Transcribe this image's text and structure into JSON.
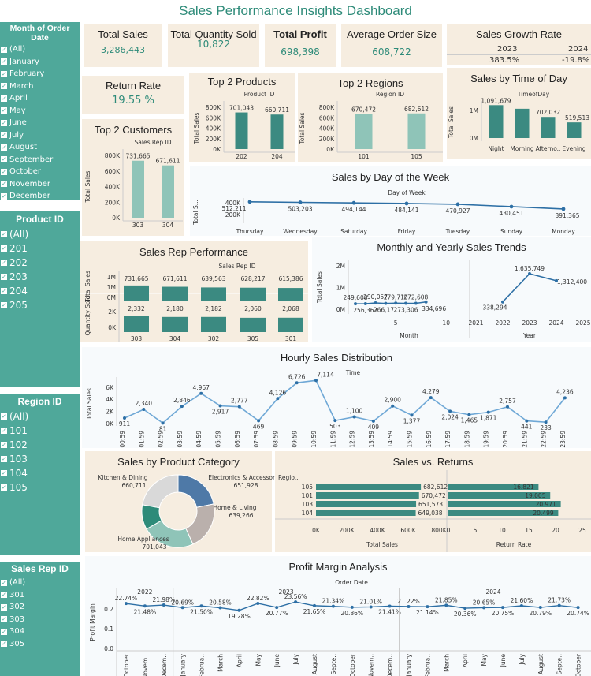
{
  "title": "Sales Performance Insights Dashboard",
  "filters": {
    "month": {
      "title": "Month of Order Date",
      "items": [
        "(All)",
        "January",
        "February",
        "March",
        "April",
        "May",
        "June",
        "July",
        "August",
        "September",
        "October",
        "November",
        "December"
      ]
    },
    "product": {
      "title": "Product ID",
      "items": [
        "(All)",
        "201",
        "202",
        "203",
        "204",
        "205"
      ]
    },
    "region": {
      "title": "Region ID",
      "items": [
        "(All)",
        "101",
        "102",
        "103",
        "104",
        "105"
      ]
    },
    "salesrep": {
      "title": "Sales Rep ID",
      "items": [
        "(All)",
        "301",
        "302",
        "303",
        "304",
        "305"
      ]
    }
  },
  "kpis": {
    "total_sales": {
      "label": "Total Sales",
      "value": "3,286,443"
    },
    "total_quantity": {
      "label": "Total Quantity Sold",
      "value": "10,822"
    },
    "total_profit": {
      "label": "Total Profit",
      "value": "698,398"
    },
    "avg_order": {
      "label": "Average Order Size",
      "value": "608,722"
    },
    "growth": {
      "label": "Sales Growth Rate",
      "y1": "2023",
      "y2": "2024",
      "v1": "383.5%",
      "v2": "-19.8%"
    },
    "return_rate": {
      "label": "Return Rate",
      "value": "19.55 %"
    }
  },
  "colors": {
    "sidebar": "#4fa89a",
    "bar_dark": "#3b8a81",
    "bar_light": "#8fc4b8",
    "line": "#2d6fa5",
    "line_light": "#6fa8d6"
  },
  "chart_data": [
    {
      "id": "top2products",
      "type": "bar",
      "title": "Top 2 Products",
      "xlabel": "Product ID",
      "ylabel": "Total Sales",
      "categories": [
        "202",
        "204"
      ],
      "values": [
        701043,
        660711
      ],
      "value_labels": [
        "701,043",
        "660,711"
      ],
      "ylim": [
        0,
        800000
      ],
      "yticks": [
        "0K",
        "200K",
        "400K",
        "600K",
        "800K"
      ]
    },
    {
      "id": "top2regions",
      "type": "bar",
      "title": "Top 2 Regions",
      "xlabel": "Region ID",
      "ylabel": "Total Sales",
      "categories": [
        "101",
        "105"
      ],
      "values": [
        670472,
        682612
      ],
      "value_labels": [
        "670,472",
        "682,612"
      ],
      "ylim": [
        0,
        800000
      ],
      "yticks": [
        "0K",
        "200K",
        "400K",
        "600K",
        "800K"
      ]
    },
    {
      "id": "top2customers",
      "type": "bar",
      "title": "Top 2 Customers",
      "xlabel": "Sales Rep ID",
      "ylabel": "Total Sales",
      "categories": [
        "303",
        "304"
      ],
      "values": [
        731665,
        671611
      ],
      "value_labels": [
        "731,665",
        "671,611"
      ],
      "ylim": [
        0,
        800000
      ],
      "yticks": [
        "0K",
        "200K",
        "400K",
        "600K",
        "800K"
      ]
    },
    {
      "id": "timeofday",
      "type": "bar",
      "title": "Sales by Time of Day",
      "xlabel": "TimeofDay",
      "ylabel": "Total Sales",
      "categories": [
        "Night",
        "Morning",
        "Afterno..",
        "Evening"
      ],
      "values": [
        1091679,
        972578,
        702032,
        519513
      ],
      "value_labels": [
        "1,091,679",
        "",
        "702,032",
        "519,513"
      ],
      "ylim": [
        0,
        1000000
      ],
      "yticks": [
        "0M",
        "1M"
      ]
    },
    {
      "id": "dayofweek",
      "type": "line",
      "title": "Sales by Day of the Week",
      "xlabel": "Day of Week",
      "ylabel": "Total S...",
      "categories": [
        "Thursday",
        "Wednesday",
        "Saturday",
        "Friday",
        "Tuesday",
        "Sunday",
        "Monday"
      ],
      "values": [
        512211,
        503203,
        494144,
        484141,
        470927,
        430451,
        391365
      ],
      "value_labels": [
        "512,211",
        "503,203",
        "494,144",
        "484,141",
        "470,927",
        "430,451",
        "391,365"
      ],
      "yticks": [
        "200K",
        "400K"
      ]
    },
    {
      "id": "salesrep",
      "type": "bar",
      "title": "Sales Rep Performance",
      "xlabel": "Sales Rep ID",
      "categories": [
        "303",
        "304",
        "302",
        "305",
        "301"
      ],
      "series": [
        {
          "name": "Total Sales",
          "values": [
            731665,
            671611,
            639563,
            628217,
            615386
          ],
          "value_labels": [
            "731,665",
            "671,611",
            "639,563",
            "628,217",
            "615,386"
          ],
          "yticks": [
            "0M",
            "1M",
            "1M"
          ]
        },
        {
          "name": "Quantity Sold",
          "values": [
            2332,
            2180,
            2182,
            2060,
            2068
          ],
          "value_labels": [
            "2,332",
            "2,180",
            "2,182",
            "2,060",
            "2,068"
          ],
          "yticks": [
            "0K",
            "2K"
          ]
        }
      ]
    },
    {
      "id": "monthly_yearly",
      "type": "line",
      "title": "Monthly and Yearly Sales Trends",
      "ylabel": "Total Sales",
      "monthly": {
        "xlabel": "Month",
        "x": [
          1,
          2,
          3,
          4,
          5,
          6,
          7,
          8,
          9,
          10,
          11,
          12
        ],
        "values": [
          249608,
          256367,
          290057,
          266171,
          279710,
          273306,
          272608,
          334696
        ],
        "value_labels": [
          "249,608",
          "256,367",
          "290,057",
          "266,171",
          "279,710",
          "273,306",
          "272,608",
          "334,696"
        ],
        "xticks": [
          "5",
          "10"
        ]
      },
      "yearly": {
        "xlabel": "Year",
        "x": [
          2022,
          2023,
          2024
        ],
        "values": [
          338294,
          1635749,
          1312400
        ],
        "value_labels": [
          "338,294",
          "1,635,749",
          "1,312,400"
        ],
        "xticks": [
          "2021",
          "2022",
          "2023",
          "2024",
          "2025"
        ]
      },
      "yticks": [
        "0M",
        "1M",
        "2M"
      ]
    },
    {
      "id": "hourly",
      "type": "line",
      "title": "Hourly Sales Distribution",
      "xlabel": "Time",
      "ylabel": "Total Sales",
      "categories": [
        "00:59",
        "01:59",
        "02:59",
        "03:59",
        "04:59",
        "05:59",
        "06:59",
        "07:59",
        "08:59",
        "09:59",
        "10:59",
        "11:59",
        "12:59",
        "13:59",
        "14:59",
        "15:59",
        "16:59",
        "17:59",
        "18:59",
        "19:59",
        "20:59",
        "21:59",
        "22:59",
        "23:59"
      ],
      "values": [
        911,
        2340,
        81,
        2846,
        4967,
        2917,
        2777,
        469,
        4126,
        6726,
        7114,
        503,
        1100,
        409,
        2900,
        1377,
        4279,
        2024,
        1465,
        1871,
        2757,
        441,
        233,
        4236
      ],
      "value_labels": [
        "911",
        "2,340",
        "81",
        "2,846",
        "4,967",
        "2,917",
        "2,777",
        "469",
        "4,126",
        "6,726",
        "7,114",
        "503",
        "1,100",
        "409",
        "2,900",
        "1,377",
        "4,279",
        "2,024",
        "1,465",
        "1,871",
        "2,757",
        "441",
        "233",
        "4,236"
      ],
      "yticks": [
        "0K",
        "2K",
        "4K",
        "6K"
      ],
      "ylim": [
        0,
        6500
      ]
    },
    {
      "id": "category",
      "type": "pie",
      "title": "Sales by Product Category",
      "slices": [
        {
          "name": "Electronics & Accessories",
          "value": 651928,
          "label": "651,928",
          "color": "#4e79a7"
        },
        {
          "name": "Home & Living",
          "value": 639266,
          "label": "639,266",
          "color": "#bab0ac"
        },
        {
          "name": "Home Appliances",
          "value": 701043,
          "label": "701,043",
          "color": "#8fc4b8"
        },
        {
          "name": "",
          "value": 330000,
          "label": "",
          "color": "#2e8b79"
        },
        {
          "name": "Kitchen & Dining",
          "value": 660711,
          "label": "660,711",
          "color": "#d9d9d9"
        }
      ]
    },
    {
      "id": "sales_returns",
      "type": "bar",
      "title": "Sales vs. Returns",
      "rowheader": "Regio..",
      "categories": [
        "105",
        "101",
        "103",
        "104"
      ],
      "sales": [
        682612,
        670472,
        651573,
        649038
      ],
      "sales_labels": [
        "682,612",
        "670,472",
        "651,573",
        "649,038"
      ],
      "returns": [
        16.821,
        19.005,
        20.971,
        20.499
      ],
      "return_labels": [
        "16.821",
        "19.005",
        "20.971",
        "20.499"
      ],
      "xlabel_sales": "Total Sales",
      "xlabel_returns": "Return Rate",
      "sales_ticks": [
        "0K",
        "200K",
        "400K",
        "600K",
        "800K"
      ],
      "return_ticks": [
        "0",
        "5",
        "10",
        "15",
        "20",
        "25"
      ]
    },
    {
      "id": "profit_margin",
      "type": "line",
      "title": "Profit Margin Analysis",
      "xlabel": "Order Date",
      "ylabel": "Profit Margin",
      "yticks": [
        "0.0",
        "0.1",
        "0.2"
      ],
      "years": [
        {
          "year": "2022",
          "months": [
            "October",
            "Novem..",
            "Decem.."
          ],
          "values": [
            0.2274,
            0.2148,
            0.2198
          ],
          "labels": [
            "22.74%",
            "21.48%",
            "21.98%"
          ]
        },
        {
          "year": "2023",
          "months": [
            "January",
            "Februa..",
            "March",
            "April",
            "May",
            "June",
            "July",
            "August",
            "Septe..",
            "October",
            "Novem..",
            "Decem.."
          ],
          "values": [
            0.2069,
            0.215,
            0.2058,
            0.1928,
            0.2282,
            0.2077,
            0.2356,
            0.2165,
            0.2134,
            0.2086,
            0.2101,
            0.2141
          ],
          "labels": [
            "20.69%",
            "21.50%",
            "20.58%",
            "19.28%",
            "22.82%",
            "20.77%",
            "23.56%",
            "21.65%",
            "21.34%",
            "20.86%",
            "21.01%",
            "21.41%"
          ]
        },
        {
          "year": "2024",
          "months": [
            "January",
            "Februa..",
            "March",
            "April",
            "May",
            "June",
            "July",
            "August",
            "Septe..",
            "October"
          ],
          "values": [
            0.2122,
            0.2114,
            0.2185,
            0.2036,
            0.2065,
            0.2075,
            0.216,
            0.2079,
            0.2173,
            0.2074
          ],
          "labels": [
            "21.22%",
            "21.14%",
            "21.85%",
            "20.36%",
            "20.65%",
            "20.75%",
            "21.60%",
            "20.79%",
            "21.73%",
            "20.74%"
          ]
        }
      ]
    }
  ]
}
